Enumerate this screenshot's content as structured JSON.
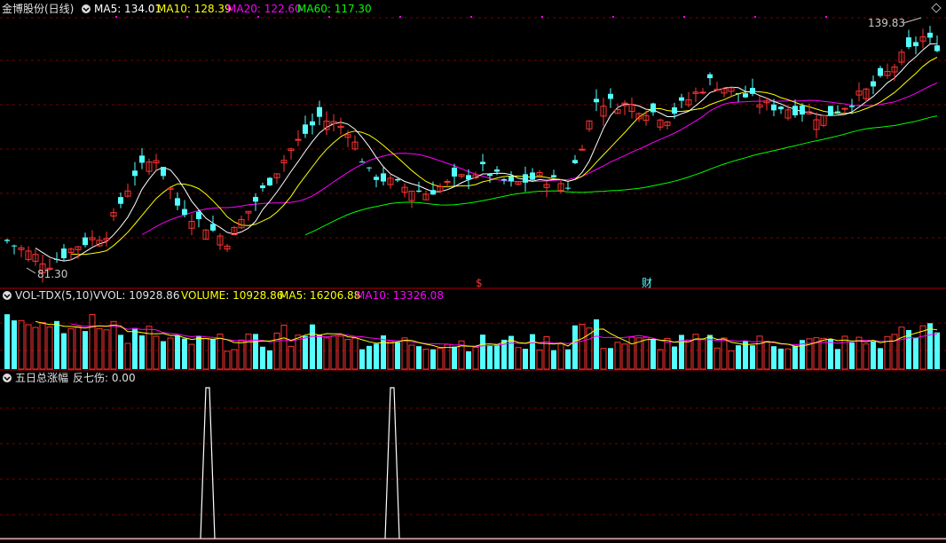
{
  "main_header": {
    "stock": "金博股份(日线)",
    "ma5": "MA5: 134.01",
    "ma10": "MA10: 128.39",
    "ma20": "MA20: 122.60",
    "ma60": "MA60: 117.30"
  },
  "vol_header": {
    "name": "VOL-TDX(5,10)",
    "vvol": "VVOL: 10928.86",
    "volume": "VOLUME: 10928.86",
    "ma5": "MA5: 16206.88",
    "ma10": "MA10: 13326.08"
  },
  "ind_header": {
    "name": "五日总涨幅",
    "value": "反七伤: 0.00"
  },
  "markers": {
    "high_label": "139.83",
    "low_label": "81.30",
    "event1": "$",
    "event2": "财"
  },
  "colors": {
    "up": "#ff3333",
    "down": "#54ffff",
    "ma5": "#ffffff",
    "ma10": "#ffff00",
    "ma20": "#ff00ff",
    "ma60": "#00ff00",
    "grid": "#7a0000",
    "axis": "#b00000"
  },
  "chart_data": [
    {
      "type": "candlestick",
      "title": "金博股份(日线)",
      "ylim": [
        78,
        143
      ],
      "high": 139.83,
      "low": 81.3,
      "n_bars": 132,
      "series": [
        {
          "name": "MA5",
          "value": 134.01
        },
        {
          "name": "MA10",
          "value": 128.39
        },
        {
          "name": "MA20",
          "value": 122.6
        },
        {
          "name": "MA60",
          "value": 117.3
        }
      ]
    },
    {
      "type": "bar",
      "title": "VOL-TDX(5,10)",
      "series": [
        {
          "name": "VOLUME",
          "value": 10928.86
        },
        {
          "name": "MA5",
          "value": 16206.88
        },
        {
          "name": "MA10",
          "value": 13326.08
        }
      ]
    },
    {
      "type": "line",
      "title": "五日总涨幅",
      "series": [
        {
          "name": "反七伤",
          "value": 0.0,
          "spikes_at_bar": [
            28,
            55
          ]
        }
      ]
    }
  ]
}
